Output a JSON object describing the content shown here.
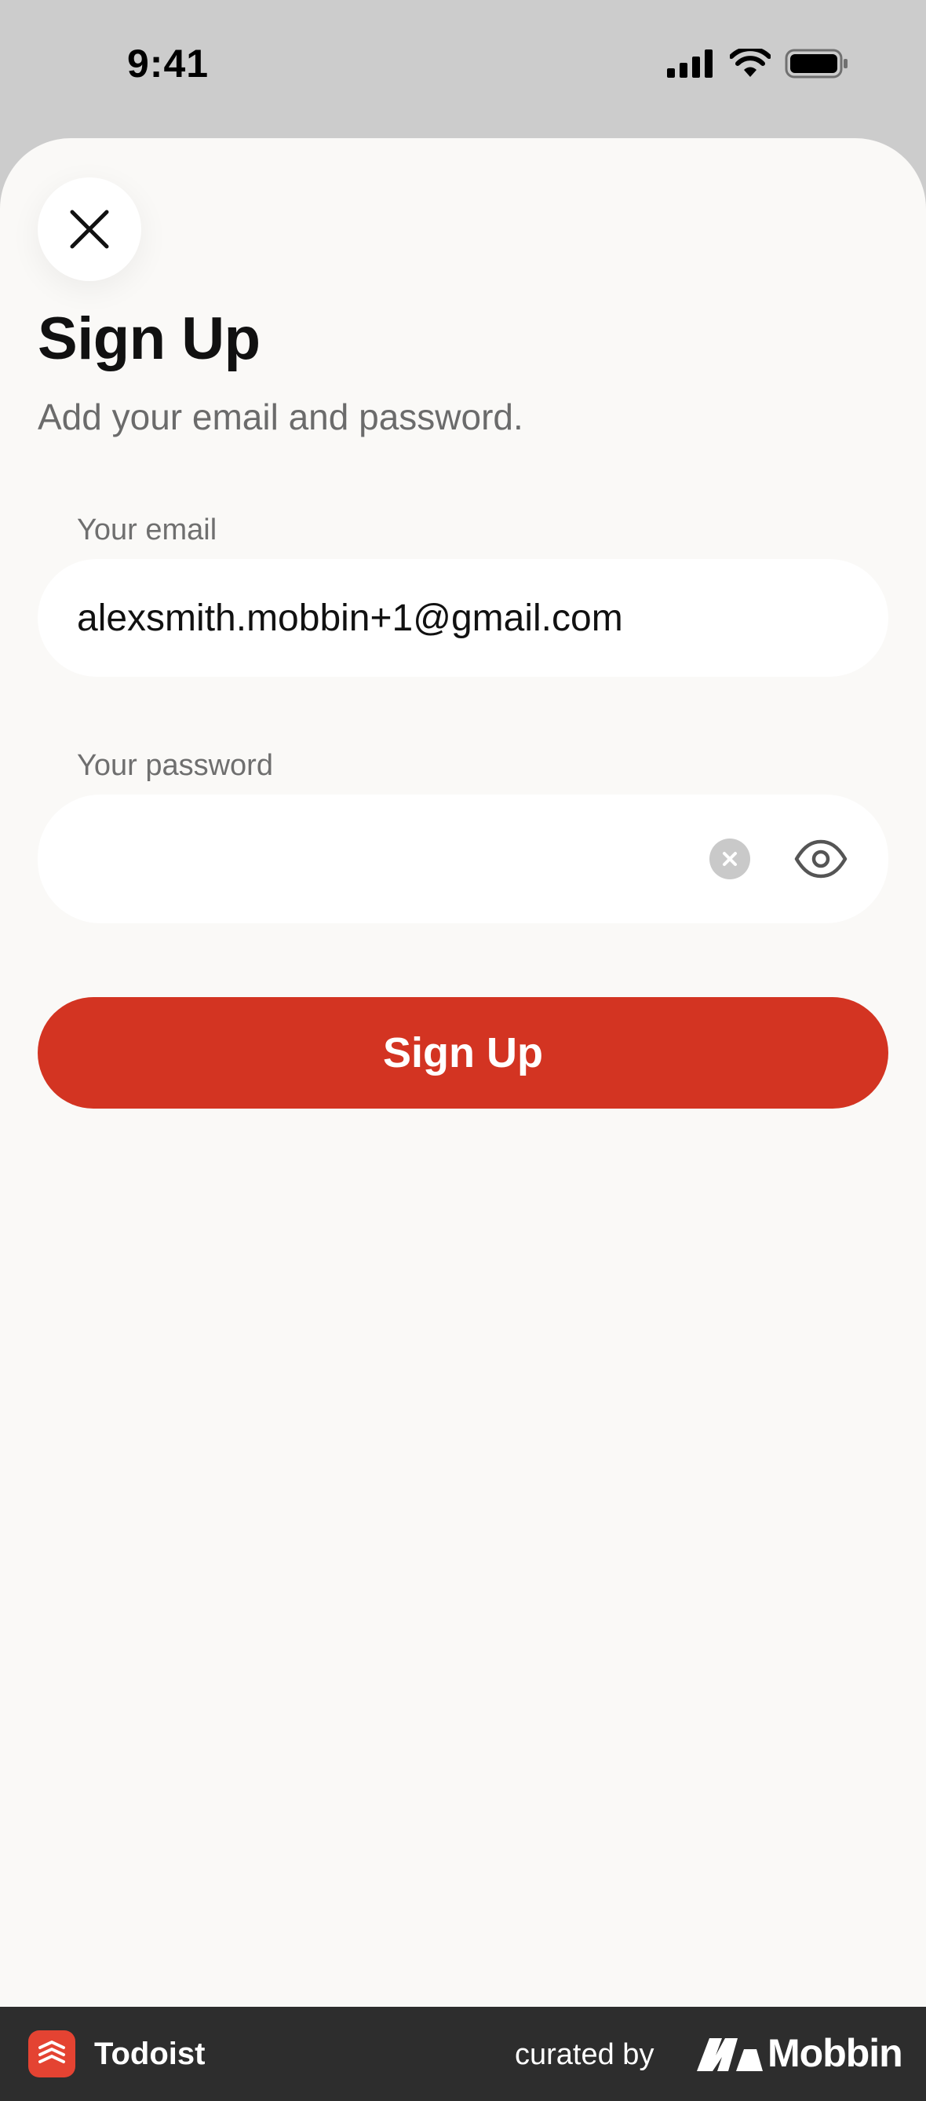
{
  "status_bar": {
    "time": "9:41"
  },
  "sheet": {
    "title": "Sign Up",
    "subtitle": "Add your email and password.",
    "close_icon": "close-icon"
  },
  "email": {
    "label": "Your email",
    "value": "alexsmith.mobbin+1@gmail.com"
  },
  "password": {
    "label": "Your password",
    "value": "",
    "clear_icon": "clear-icon",
    "reveal_icon": "eye-icon"
  },
  "primary_button": {
    "label": "Sign Up"
  },
  "footer": {
    "app_name": "Todoist",
    "curated_by": "curated by",
    "brand": "Mobbin"
  },
  "colors": {
    "accent": "#d33422",
    "sheet_background": "#faf9f7",
    "status_background": "#cccccc",
    "footer_background": "#2d2d2d",
    "todoist_red": "#e44332"
  }
}
